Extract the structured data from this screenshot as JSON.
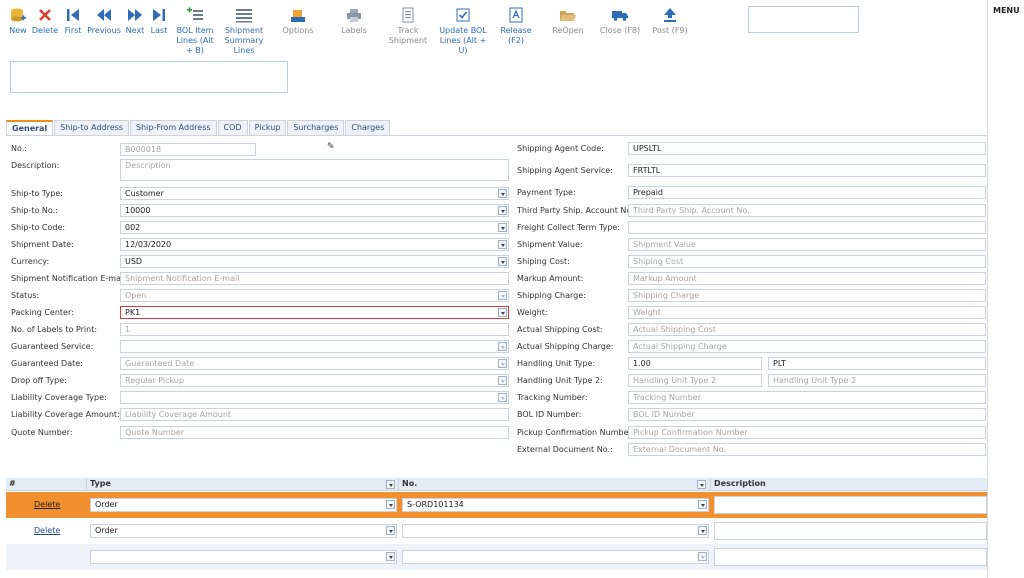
{
  "toolbar": {
    "new": "New",
    "delete": "Delete",
    "first": "First",
    "previous": "Previous",
    "next": "Next",
    "last": "Last",
    "bol_item_lines": "BOL Item Lines (Alt + B)",
    "shipment_summary_lines": "Shipment Summary Lines",
    "options": "Options",
    "labels": "Labels",
    "track_shipment": "Track Shipment",
    "update_bol_lines": "Update BOL Lines (Alt + U)",
    "release": "Release (F2)",
    "reopen": "ReOpen",
    "close": "Close (F8)",
    "post": "Post (F9)"
  },
  "menu_label": "MENU",
  "tabs": [
    "General",
    "Ship-to Address",
    "Ship-From Address",
    "COD",
    "Pickup",
    "Surcharges",
    "Charges"
  ],
  "left_form": {
    "no_label": "No.:",
    "no_value": "B000018",
    "description_label": "Description:",
    "description_ph": "Description",
    "ship_to_type_label": "Ship-to Type:",
    "ship_to_type_value": "Customer",
    "ship_to_no_label": "Ship-to No.:",
    "ship_to_no_value": "10000",
    "ship_to_code_label": "Ship-to Code:",
    "ship_to_code_value": "002",
    "shipment_date_label": "Shipment Date:",
    "shipment_date_value": "12/03/2020",
    "currency_label": "Currency:",
    "currency_value": "USD",
    "notif_email_label": "Shipment Notification E-mail:",
    "notif_email_ph": "Shipment Notification E-mail",
    "status_label": "Status:",
    "status_value": "Open",
    "packing_center_label": "Packing Center:",
    "packing_center_value": "PK1",
    "labels_to_print_label": "No. of Labels to Print:",
    "labels_to_print_value": "1",
    "guaranteed_service_label": "Guaranteed Service:",
    "guaranteed_date_label": "Guaranteed Date:",
    "guaranteed_date_ph": "Guaranteed Date",
    "drop_off_type_label": "Drop off Type:",
    "drop_off_type_value": "Regular Pickup",
    "liability_type_label": "Liability Coverage Type:",
    "liability_amount_label": "Liability Coverage Amount:",
    "liability_amount_ph": "Liability Coverage Amount",
    "quote_number_label": "Quote Number:",
    "quote_number_ph": "Quote Number"
  },
  "right_form": {
    "agent_code_label": "Shipping Agent Code:",
    "agent_code_value": "UPSLTL",
    "agent_service_label": "Shipping Agent Service:",
    "agent_service_value": "FRTLTL",
    "payment_type_label": "Payment Type:",
    "payment_type_value": "Prepaid",
    "third_party_label": "Third Party Ship. Account No.:",
    "third_party_ph": "Third Party Ship. Account No.",
    "freight_collect_label": "Freight Collect Term Type:",
    "shipment_value_label": "Shipment Value:",
    "shipment_value_ph": "Shipment Value",
    "shiping_cost_label": "Shiping Cost:",
    "shiping_cost_ph": "Shiping Cost",
    "markup_label": "Markup Amount:",
    "markup_ph": "Markup Amount",
    "shipping_charge_label": "Shipping Charge:",
    "shipping_charge_ph": "Shipping Charge",
    "weight_label": "Weight:",
    "weight_ph": "Weight",
    "actual_cost_label": "Actual Shipping Cost:",
    "actual_cost_ph": "Actual Shipping Cost",
    "actual_charge_label": "Actual Shipping Charge:",
    "actual_charge_ph": "Actual Shipping Charge",
    "hu_type_label": "Handling Unit Type:",
    "hu_type_value": "1.00",
    "hu_type_unit": "PLT",
    "hu_type2_label": "Handling Unit Type 2:",
    "hu_type2_ph": "Handling Unit Type 2",
    "tracking_label": "Tracking Number:",
    "tracking_ph": "Tracking Number",
    "bol_id_label": "BOL ID Number:",
    "bol_id_ph": "BOL ID Number",
    "pickup_conf_label": "Pickup Confirmation Number:",
    "pickup_conf_ph": "Pickup Confirmation Number",
    "ext_doc_label": "External Document No.:",
    "ext_doc_ph": "External Document No."
  },
  "grid": {
    "headers": {
      "hash": "#",
      "type": "Type",
      "no": "No.",
      "description": "Description"
    },
    "rows": [
      {
        "action": "Delete",
        "type": "Order",
        "no": "S-ORD101134",
        "description": ""
      },
      {
        "action": "Delete",
        "type": "Order",
        "no": "",
        "description": ""
      },
      {
        "action": "",
        "type": "",
        "no": "",
        "description": ""
      }
    ]
  },
  "colors": {
    "accent": "#f28f2e",
    "link": "#2e6db4",
    "highlight_border": "#d13d3d"
  }
}
